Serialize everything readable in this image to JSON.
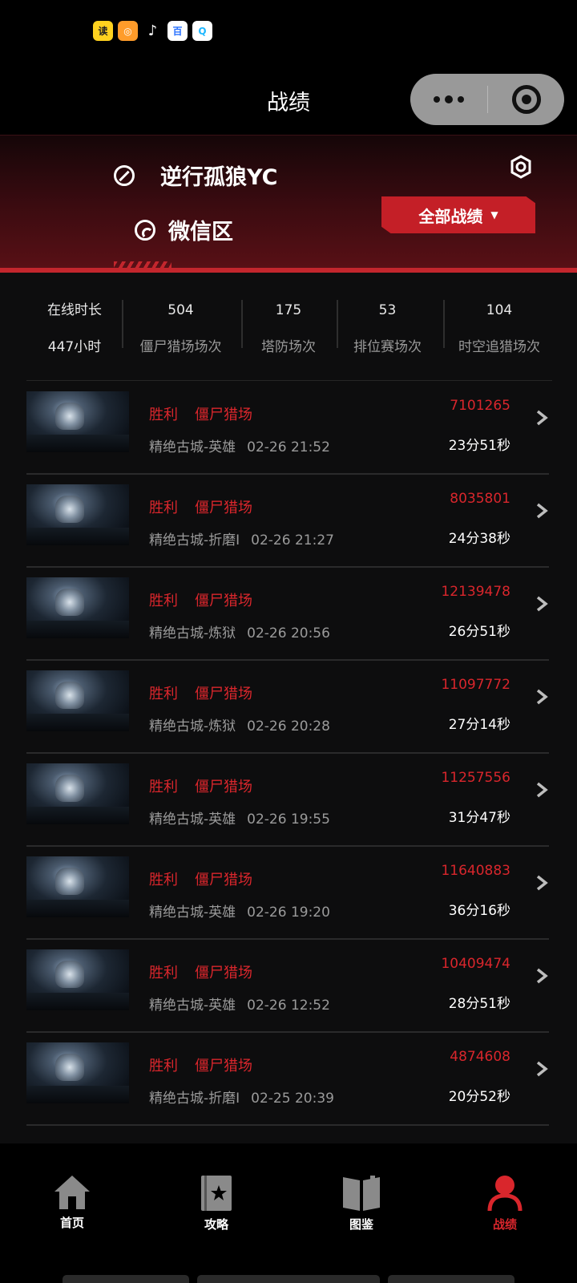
{
  "status_bar": {
    "app_icons": [
      {
        "name": "app-icon-yellow",
        "glyph": "读"
      },
      {
        "name": "app-icon-orange",
        "glyph": "◎"
      },
      {
        "name": "tiktok-icon",
        "glyph": "♪"
      },
      {
        "name": "baidu-icon",
        "glyph": "百"
      },
      {
        "name": "search-app-icon",
        "glyph": "Q"
      }
    ]
  },
  "header": {
    "title": "战绩",
    "menu_icon": "more-dots-icon",
    "close_icon": "miniprogram-close-icon"
  },
  "profile": {
    "name": "逆行孤狼YC",
    "zone": "微信区",
    "all_records_label": "全部战绩",
    "dropdown_caret": "▼",
    "accent_color": "#c41f27"
  },
  "stats": [
    {
      "top": "在线时长",
      "bottom": "447小时"
    },
    {
      "top": "504",
      "bottom": "僵尸猎场场次"
    },
    {
      "top": "175",
      "bottom": "塔防场次"
    },
    {
      "top": "53",
      "bottom": "排位赛场次"
    },
    {
      "top": "104",
      "bottom": "时空追猎场次"
    }
  ],
  "matches": [
    {
      "result": "胜利",
      "mode": "僵尸猎场",
      "map": "精绝古城-英雄",
      "time": "02-26 21:52",
      "score": "7101265",
      "duration": "23分51秒"
    },
    {
      "result": "胜利",
      "mode": "僵尸猎场",
      "map": "精绝古城-折磨I",
      "time": "02-26 21:27",
      "score": "8035801",
      "duration": "24分38秒"
    },
    {
      "result": "胜利",
      "mode": "僵尸猎场",
      "map": "精绝古城-炼狱",
      "time": "02-26 20:56",
      "score": "12139478",
      "duration": "26分51秒"
    },
    {
      "result": "胜利",
      "mode": "僵尸猎场",
      "map": "精绝古城-炼狱",
      "time": "02-26 20:28",
      "score": "11097772",
      "duration": "27分14秒"
    },
    {
      "result": "胜利",
      "mode": "僵尸猎场",
      "map": "精绝古城-英雄",
      "time": "02-26 19:55",
      "score": "11257556",
      "duration": "31分47秒"
    },
    {
      "result": "胜利",
      "mode": "僵尸猎场",
      "map": "精绝古城-英雄",
      "time": "02-26 19:20",
      "score": "11640883",
      "duration": "36分16秒"
    },
    {
      "result": "胜利",
      "mode": "僵尸猎场",
      "map": "精绝古城-英雄",
      "time": "02-26 12:52",
      "score": "10409474",
      "duration": "28分51秒"
    },
    {
      "result": "胜利",
      "mode": "僵尸猎场",
      "map": "精绝古城-折磨I",
      "time": "02-25 20:39",
      "score": "4874608",
      "duration": "20分52秒"
    }
  ],
  "tabs": [
    {
      "label": "首页",
      "icon": "home-icon",
      "active": false
    },
    {
      "label": "攻略",
      "icon": "guide-book-icon",
      "active": false
    },
    {
      "label": "图鉴",
      "icon": "open-book-icon",
      "active": false
    },
    {
      "label": "战绩",
      "icon": "user-icon",
      "active": true
    }
  ],
  "colors": {
    "win_red": "#d9262c",
    "background": "#0d0d0e",
    "muted_text": "#9a9a9a"
  }
}
